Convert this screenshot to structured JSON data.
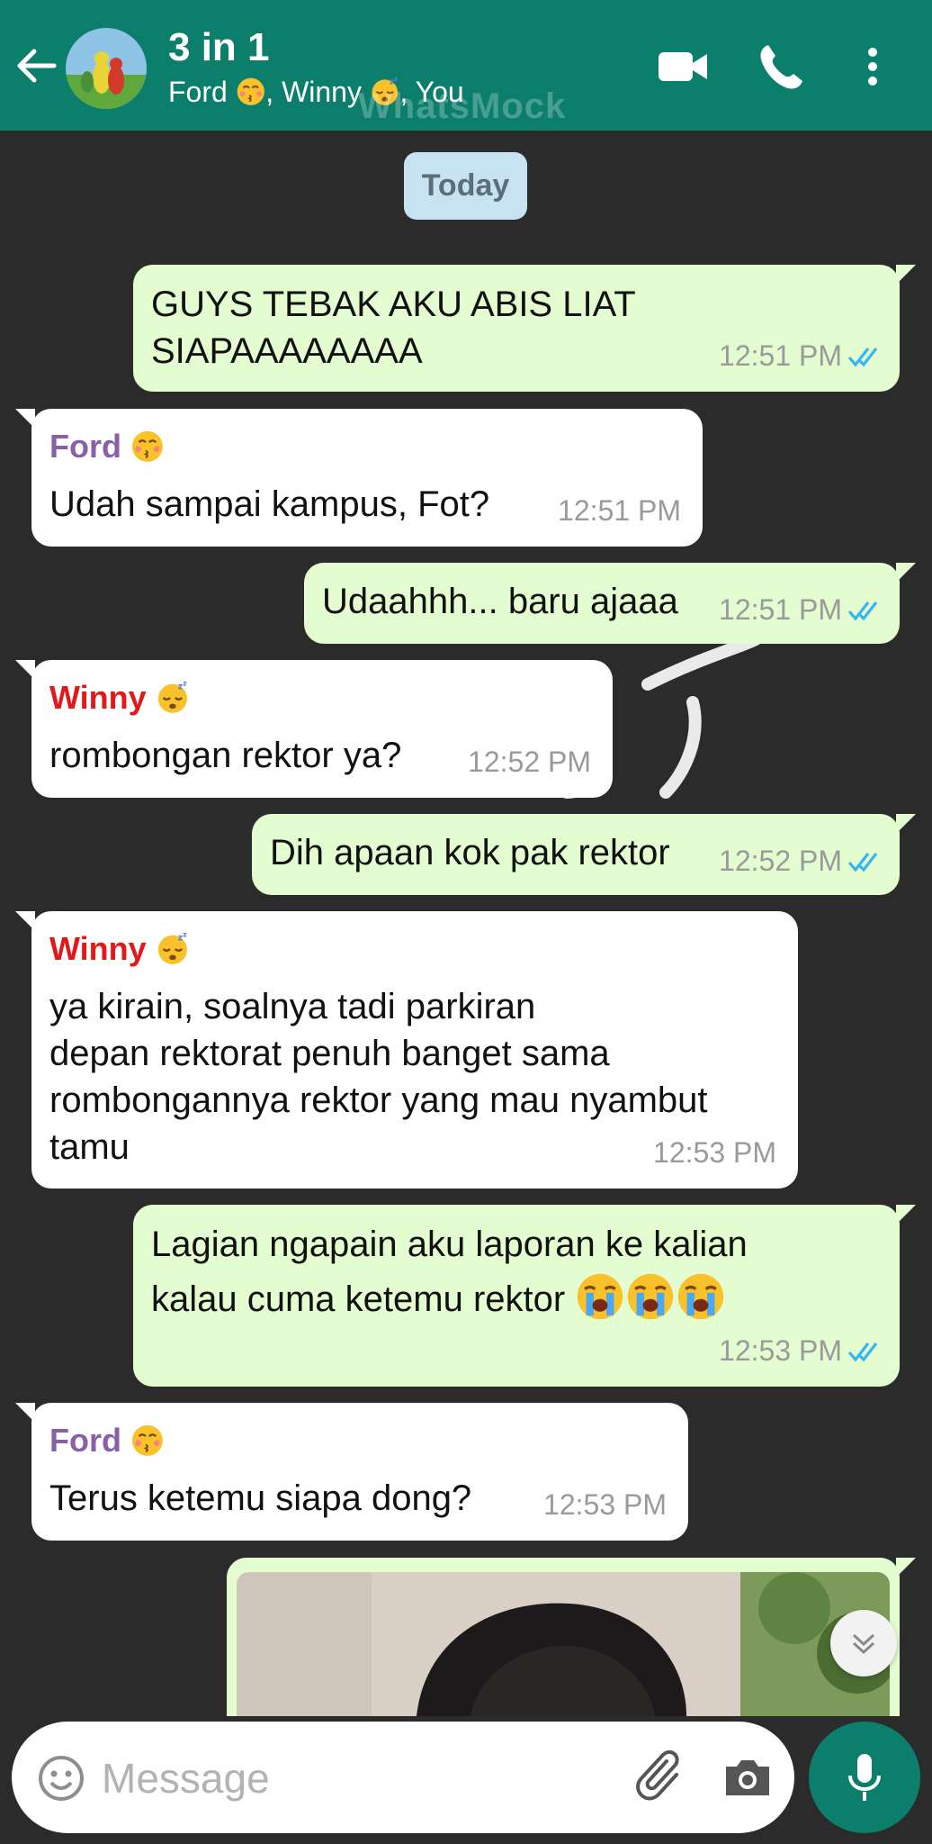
{
  "header": {
    "title": "3 in 1",
    "participants": [
      "Ford",
      "Winny",
      "You"
    ],
    "watermark": "WhatsMock",
    "background_color": "#0b7f6c"
  },
  "date_chip": "Today",
  "messages": [
    {
      "direction": "out",
      "text_lines": [
        "GUYS TEBAK AKU ABIS LIAT",
        "SIAPAAAAAAAA"
      ],
      "time": "12:51 PM",
      "read": true
    },
    {
      "direction": "in",
      "sender": "Ford",
      "sender_emoji": "kissing-face",
      "sender_color": "#8b5fa8",
      "text_lines": [
        "Udah sampai kampus, Fot?"
      ],
      "time": "12:51 PM"
    },
    {
      "direction": "out",
      "text_lines": [
        "Udaahhh... baru ajaaa"
      ],
      "time": "12:51 PM",
      "read": true
    },
    {
      "direction": "in",
      "sender": "Winny",
      "sender_emoji": "sleeping-face",
      "sender_color": "#e0191b",
      "text_lines": [
        "rombongan rektor ya?"
      ],
      "time": "12:52 PM"
    },
    {
      "direction": "out",
      "text_lines": [
        "Dih apaan kok pak rektor"
      ],
      "time": "12:52 PM",
      "read": true
    },
    {
      "direction": "in",
      "sender": "Winny",
      "sender_emoji": "sleeping-face",
      "sender_color": "#e0191b",
      "text_lines": [
        "ya kirain, soalnya tadi parkiran",
        "depan rektorat penuh banget sama",
        "rombongannya rektor yang mau nyambut",
        "tamu"
      ],
      "time": "12:53 PM"
    },
    {
      "direction": "out",
      "text_lines": [
        "Lagian ngapain aku laporan ke kalian",
        "kalau cuma ketemu rektor"
      ],
      "trailing_emoji": [
        "loudly-crying-face",
        "loudly-crying-face",
        "loudly-crying-face"
      ],
      "time": "12:53 PM",
      "read": true
    },
    {
      "direction": "in",
      "sender": "Ford",
      "sender_emoji": "kissing-face",
      "sender_color": "#8b5fa8",
      "text_lines": [
        "Terus ketemu siapa dong?"
      ],
      "time": "12:53 PM"
    }
  ],
  "input": {
    "placeholder": "Message"
  },
  "colors": {
    "outgoing_bubble": "#e4fdd0",
    "incoming_bubble": "#ffffff",
    "chat_background": "#2b2b2b",
    "read_ticks": "#34b7f1"
  }
}
